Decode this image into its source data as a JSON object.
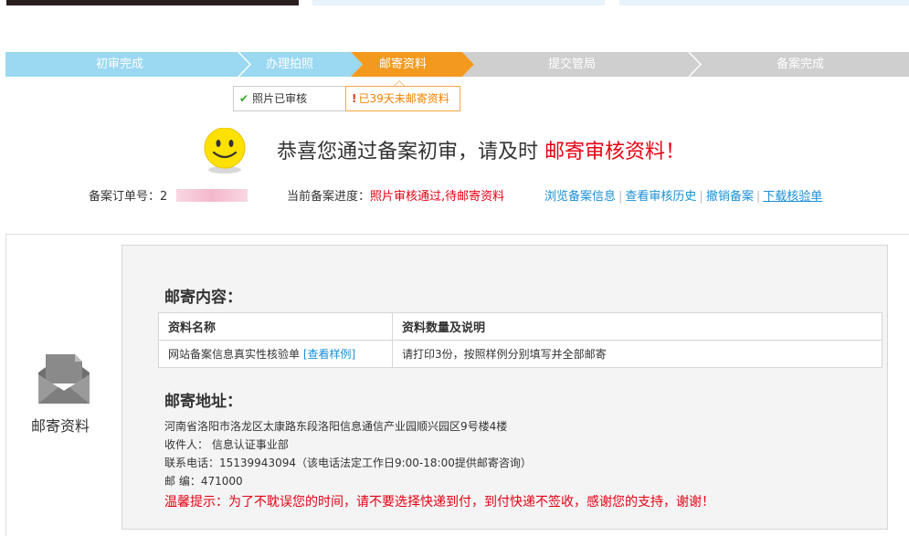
{
  "steps": [
    {
      "label": "初审完成",
      "state": "done"
    },
    {
      "label": "办理拍照",
      "state": "done"
    },
    {
      "label": "邮寄资料",
      "state": "current"
    },
    {
      "label": "提交管局",
      "state": "pending"
    },
    {
      "label": "备案完成",
      "state": "pending"
    }
  ],
  "colors": {
    "done": "#9bd8f2",
    "current": "#f39a1e",
    "pending": "#cfcfcf",
    "link": "#1a8fd6",
    "alert": "#e60012"
  },
  "status_tabs": {
    "done_label": "照片已审核",
    "warn_label": "已39天未邮寄资料"
  },
  "headline": {
    "prefix": "恭喜您通过备案初审，请及时 ",
    "highlight": "邮寄审核资料！"
  },
  "order": {
    "label": "备案订单号：",
    "value_visible": "2"
  },
  "progress": {
    "label": "当前备案进度：",
    "value": "照片审核通过,待邮寄资料"
  },
  "links": [
    "浏览备案信息",
    "查看审核历史",
    "撤销备案",
    "下载核验单"
  ],
  "sidebar": {
    "label": "邮寄资料",
    "icon": "mail-envelope-icon"
  },
  "content": {
    "title": "邮寄内容：",
    "headers": [
      "资料名称",
      "资料数量及说明"
    ],
    "rows": [
      {
        "name": "网站备案信息真实性核验单 ",
        "link": "[查看样例]",
        "desc": "请打印3份，按照样例分别填写并全部邮寄"
      }
    ]
  },
  "address": {
    "title": "邮寄地址：",
    "line1": "河南省洛阳市洛龙区太康路东段洛阳信息通信产业园顺兴园区9号楼4楼",
    "recipient": "收件人： 信息认证事业部",
    "phone": "联系电话：15139943094（该电话法定工作日9:00-18:00提供邮寄咨询）",
    "zip": "邮 编：471000",
    "tip": "温馨提示：为了不耽误您的时间，请不要选择快递到付，到付快递不签收，感谢您的支持，谢谢！"
  }
}
